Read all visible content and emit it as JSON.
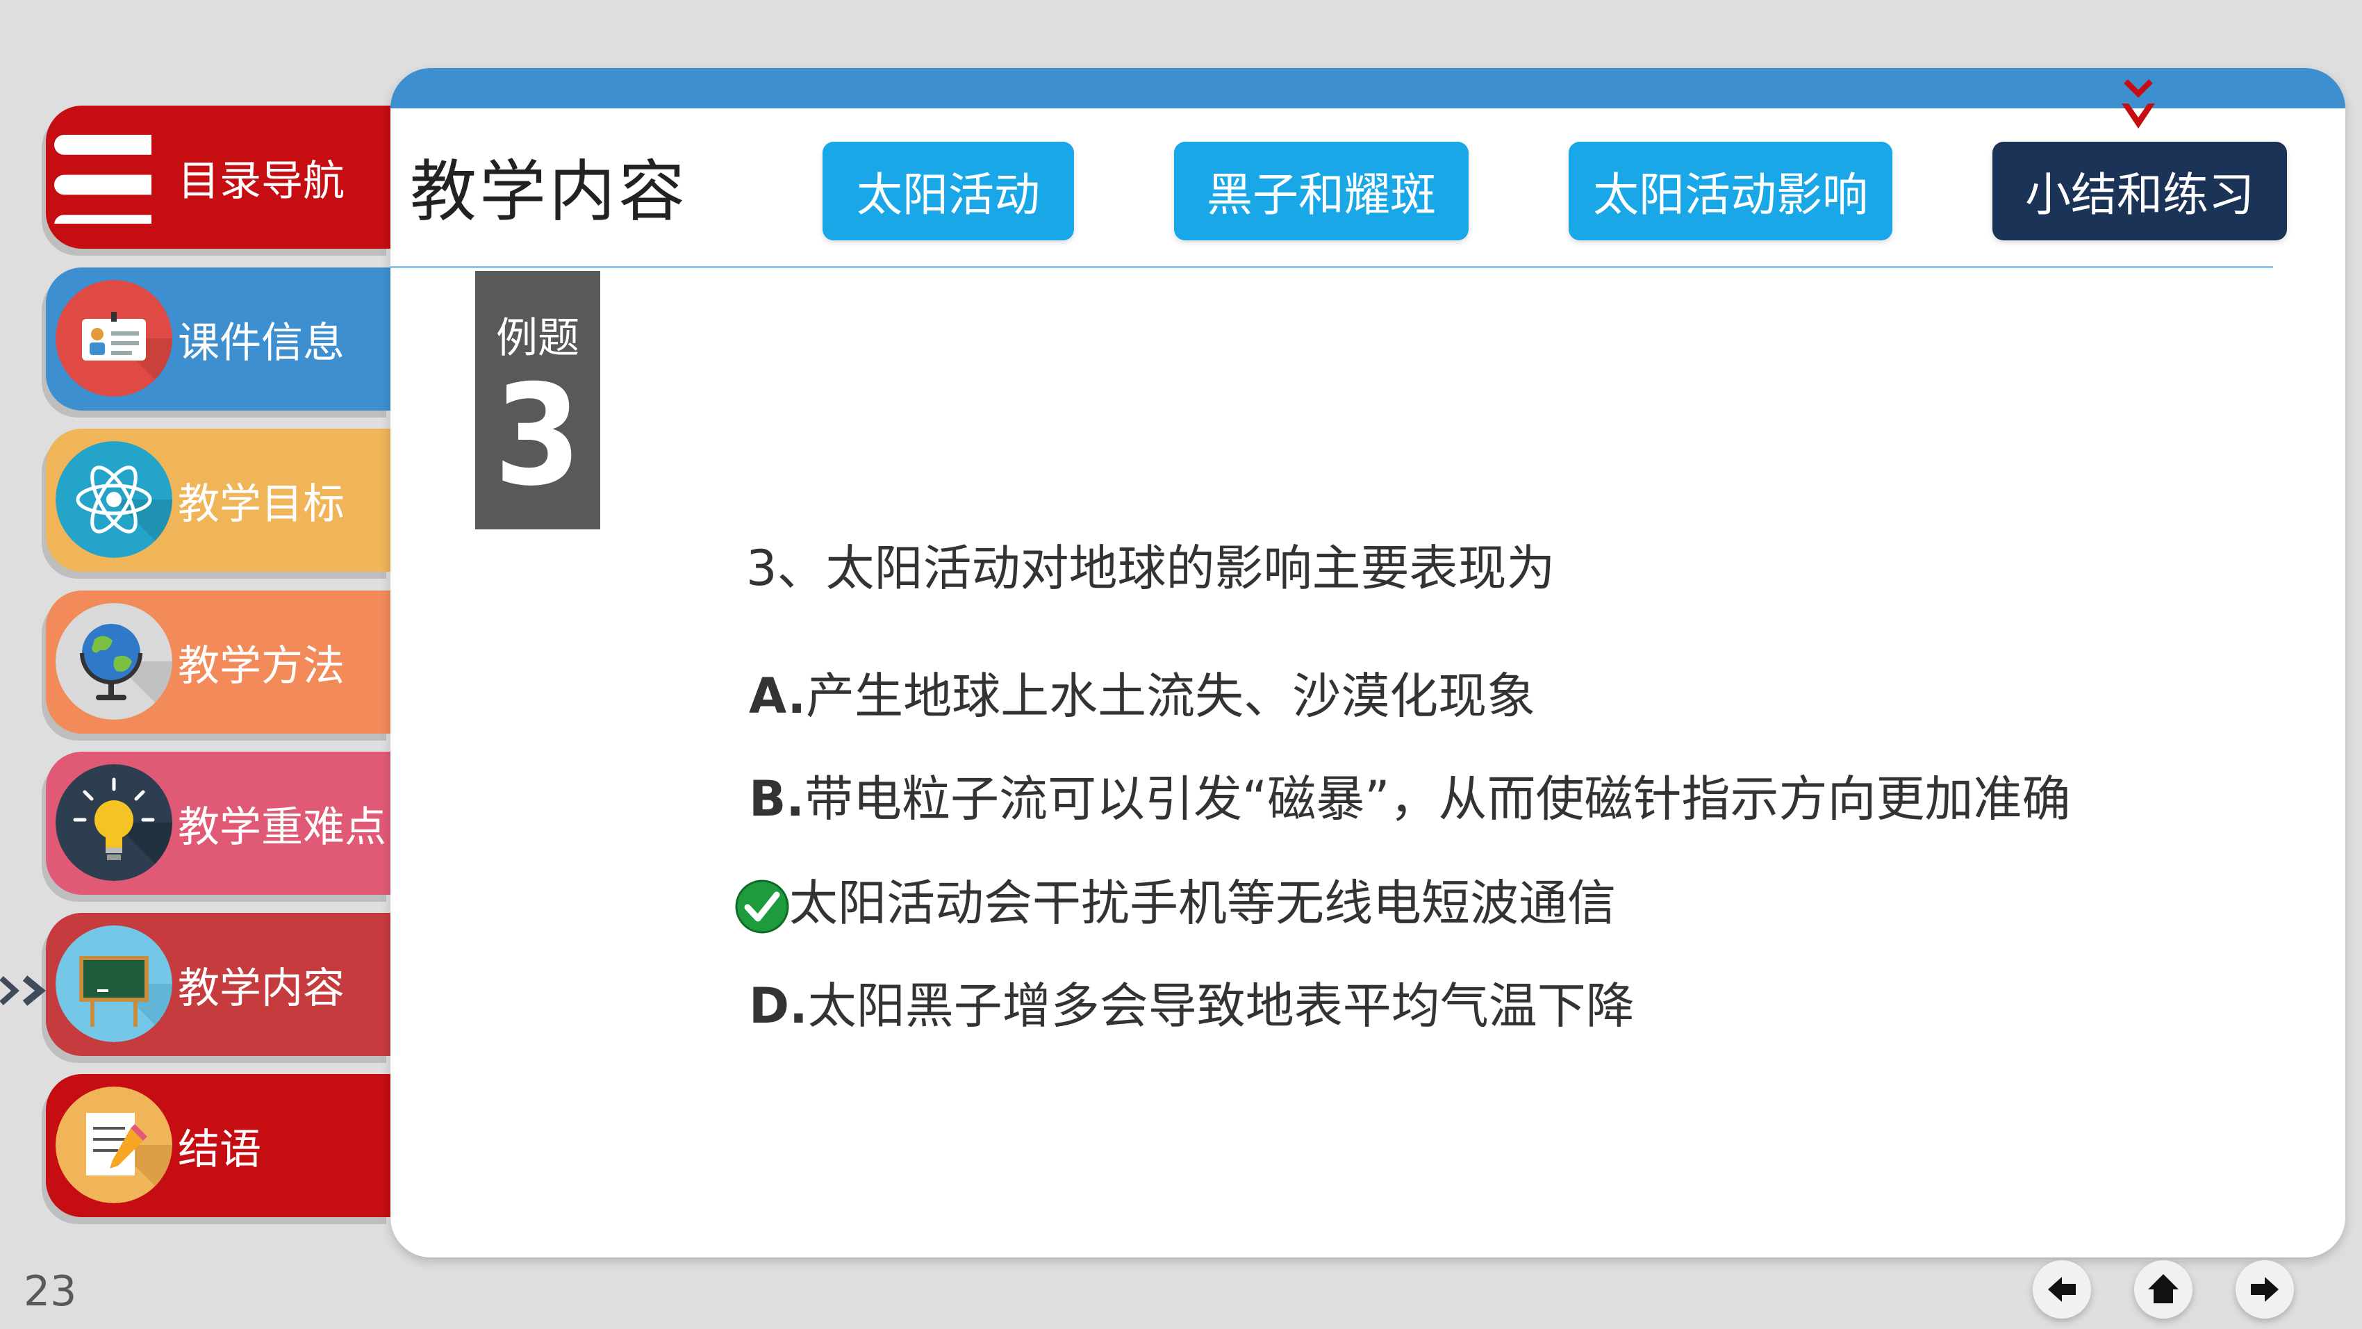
{
  "sidebar": {
    "items": [
      {
        "label": "目录导航",
        "icon": "menu-icon",
        "color": "#c60d12"
      },
      {
        "label": "课件信息",
        "icon": "id-card-icon",
        "color": "#3d8fd0"
      },
      {
        "label": "教学目标",
        "icon": "atom-icon",
        "color": "#f0b459"
      },
      {
        "label": "教学方法",
        "icon": "globe-icon",
        "color": "#f28a5a"
      },
      {
        "label": "教学重难点",
        "icon": "lightbulb-icon",
        "color": "#e05a75"
      },
      {
        "label": "教学内容",
        "icon": "blackboard-icon",
        "color": "#c63b3e"
      },
      {
        "label": "结语",
        "icon": "notepad-icon",
        "color": "#c60d12"
      }
    ],
    "active_index": 5
  },
  "header": {
    "title": "教学内容",
    "tabs": [
      {
        "label": "太阳活动"
      },
      {
        "label": "黑子和耀斑"
      },
      {
        "label": "太阳活动影响"
      },
      {
        "label": "小结和练习"
      }
    ],
    "active_tab": 3
  },
  "example": {
    "label": "例题",
    "number": "3"
  },
  "question": {
    "text": "3、太阳活动对地球的影响主要表现为",
    "options": [
      {
        "letter": "A.",
        "text": "产生地球上水土流失、沙漠化现象"
      },
      {
        "letter": "B.",
        "text": "带电粒子流可以引发“磁暴”，从而使磁针指示方向更加准确"
      },
      {
        "letter": "",
        "text": "太阳活动会干扰手机等无线电短波通信",
        "correct": true
      },
      {
        "letter": "D.",
        "text": "太阳黑子增多会导致地表平均气温下降"
      }
    ]
  },
  "footer": {
    "page_number": "23"
  },
  "colors": {
    "accent_blue": "#3d8fd0",
    "tab_blue": "#1aa7e8",
    "tab_active": "#1b3357",
    "marker_red": "#c60d12"
  }
}
